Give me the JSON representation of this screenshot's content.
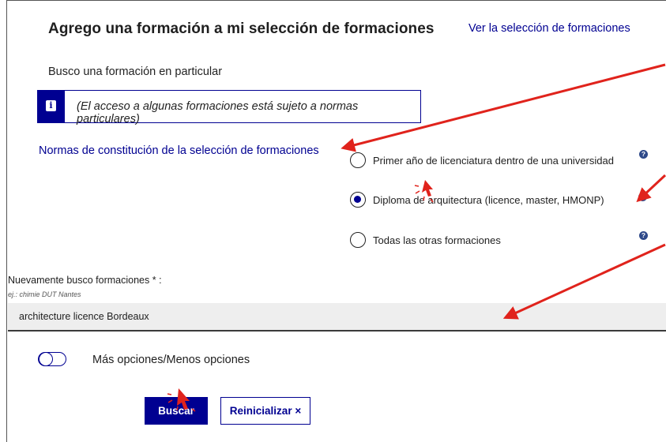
{
  "header": {
    "title": "Agrego una formación a mi selección de formaciones",
    "view_selection_link": "Ver la selección de formaciones"
  },
  "search_particular": {
    "label": "Busco una formación en particular"
  },
  "notice": {
    "icon": "info-icon",
    "text": "(El acceso a algunas formaciones está sujeto a normas particulares)"
  },
  "rules_link": "Normas de constitución de la selección de formaciones",
  "options": [
    {
      "label": "Primer año de licenciatura dentro de una universidad",
      "checked": false
    },
    {
      "label": "Diploma de arquitectura (licence, master, HMONP)",
      "checked": true
    },
    {
      "label": "Todas las otras formaciones",
      "checked": false
    }
  ],
  "help_icon_text": "?",
  "search": {
    "label": "Nuevamente busco formaciones * :",
    "hint": "ej.: chimie DUT Nantes",
    "value": "architecture licence Bordeaux"
  },
  "more_options": {
    "label": "Más opciones/Menos opciones",
    "on": false
  },
  "buttons": {
    "search": "Buscar",
    "reset": "Reinicializar ×"
  },
  "colors": {
    "primary": "#000091",
    "annotation_arrow": "#e0231c"
  }
}
